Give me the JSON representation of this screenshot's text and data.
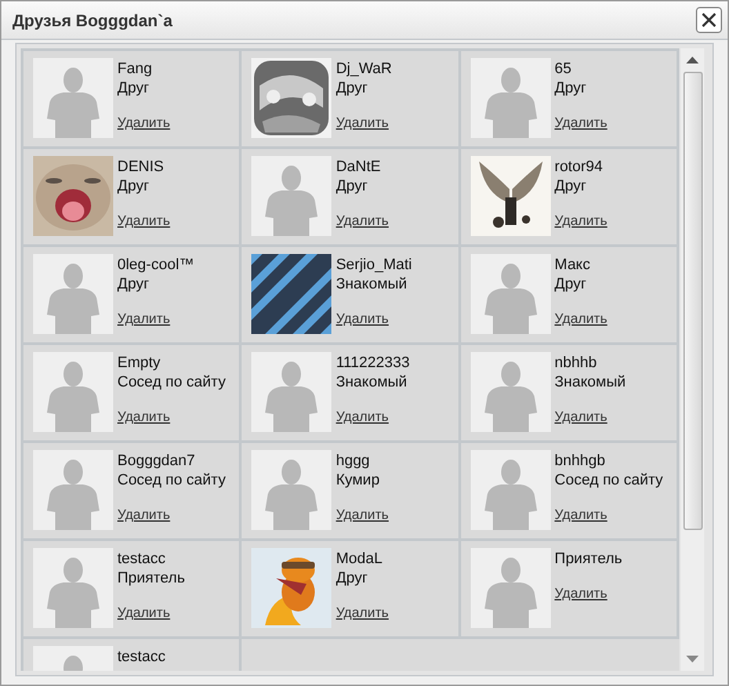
{
  "window": {
    "title": "Друзья Bogggdan`a"
  },
  "friends": [
    {
      "name": "Fang",
      "role": "Друг",
      "avatar": {
        "kind": "silhouette"
      },
      "action": "Удалить"
    },
    {
      "name": "Dj_WaR",
      "role": "Друг",
      "action": "Удалить"
    },
    {
      "name": "65",
      "role": "Друг",
      "avatar": {
        "kind": "silhouette"
      },
      "action": "Удалить"
    },
    {
      "name": "DENIS",
      "role": "Друг",
      "action": "Удалить"
    },
    {
      "name": "DaNtE",
      "role": "Друг",
      "avatar": {
        "kind": "silhouette"
      },
      "action": "Удалить"
    },
    {
      "name": "rotor94",
      "role": "Друг",
      "action": "Удалить"
    },
    {
      "name": "0leg-cool™",
      "role": "Друг",
      "avatar": {
        "kind": "silhouette"
      },
      "action": "Удалить"
    },
    {
      "name": "Serjio_Mati",
      "role": "Знакомый",
      "action": "Удалить"
    },
    {
      "name": "Макс",
      "role": "Друг",
      "avatar": {
        "kind": "silhouette"
      },
      "action": "Удалить"
    },
    {
      "name": "Empty",
      "role": "Сосед по сайту",
      "avatar": {
        "kind": "silhouette"
      },
      "action": "Удалить"
    },
    {
      "name": "111222333",
      "role": "Знакомый",
      "avatar": {
        "kind": "silhouette"
      },
      "action": "Удалить"
    },
    {
      "name": "nbhhb",
      "role": "Знакомый",
      "avatar": {
        "kind": "silhouette"
      },
      "action": "Удалить"
    },
    {
      "name": "Bogggdan7",
      "role": "Сосед по сайту",
      "avatar": {
        "kind": "silhouette"
      },
      "action": "Удалить"
    },
    {
      "name": "hggg",
      "role": "Кумир",
      "avatar": {
        "kind": "silhouette"
      },
      "action": "Удалить"
    },
    {
      "name": "bnhhgb",
      "role": "Сосед по сайту",
      "avatar": {
        "kind": "silhouette"
      },
      "action": "Удалить"
    },
    {
      "name": "testacc",
      "role": "Приятель",
      "avatar": {
        "kind": "silhouette"
      },
      "action": "Удалить"
    },
    {
      "name": "ModaL",
      "role": "Друг",
      "action": "Удалить"
    },
    {
      "role": "Приятель",
      "avatar": {
        "kind": "silhouette"
      },
      "action": "Удалить"
    },
    {
      "name": "testacc",
      "avatar": {
        "kind": "silhouette"
      }
    }
  ]
}
